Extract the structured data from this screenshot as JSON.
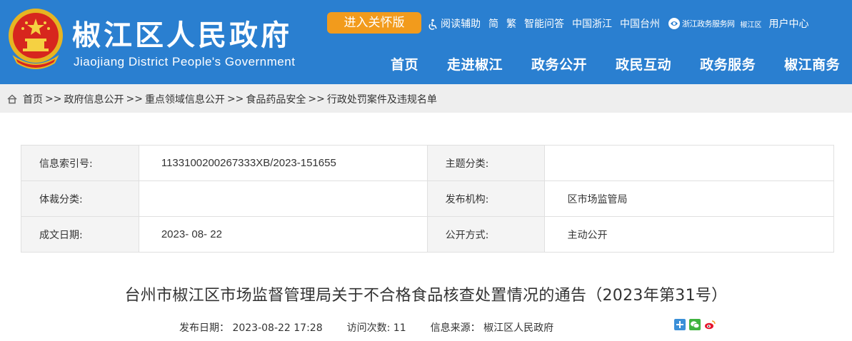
{
  "header": {
    "site_name": "椒江区人民政府",
    "site_name_en": "Jiaojiang District People's Government",
    "care_button": "进入关怀版",
    "top_links": {
      "reading_aid": "阅读辅助",
      "simplified": "简",
      "traditional": "繁",
      "smart_qa": "智能问答",
      "zhejiang": "中国浙江",
      "taizhou": "中国台州",
      "gov_service": "浙江政务服务网",
      "gov_service_sub": "椒江区",
      "user_center": "用户中心"
    },
    "nav": [
      "首页",
      "走进椒江",
      "政务公开",
      "政民互动",
      "政务服务",
      "椒江商务"
    ],
    "colors": {
      "header_bg": "#2a7fd0",
      "care_btn": "#f29b1c"
    }
  },
  "breadcrumb": {
    "items": [
      "首页",
      "政府信息公开",
      "重点领域信息公开",
      "食品药品安全",
      "行政处罚案件及违规名单"
    ],
    "separator": ">>"
  },
  "info": {
    "index_label": "信息索引号:",
    "index_value": "1133100200267333XB/2023-151655",
    "topic_label": "主题分类:",
    "topic_value": "",
    "genre_label": "体裁分类:",
    "genre_value": "",
    "publisher_label": "发布机构:",
    "publisher_value": "区市场监管局",
    "date_label": "成文日期:",
    "date_value": "2023- 08- 22",
    "disclosure_label": "公开方式:",
    "disclosure_value": "主动公开"
  },
  "article": {
    "title": "台州市椒江区市场监督管理局关于不合格食品核查处置情况的通告（2023年第31号）",
    "publish_label": "发布日期：",
    "publish_value": "2023-08-22 17:28",
    "visits_label": "访问次数:",
    "visits_value": "11",
    "source_label": "信息来源：",
    "source_value": "椒江区人民政府"
  }
}
